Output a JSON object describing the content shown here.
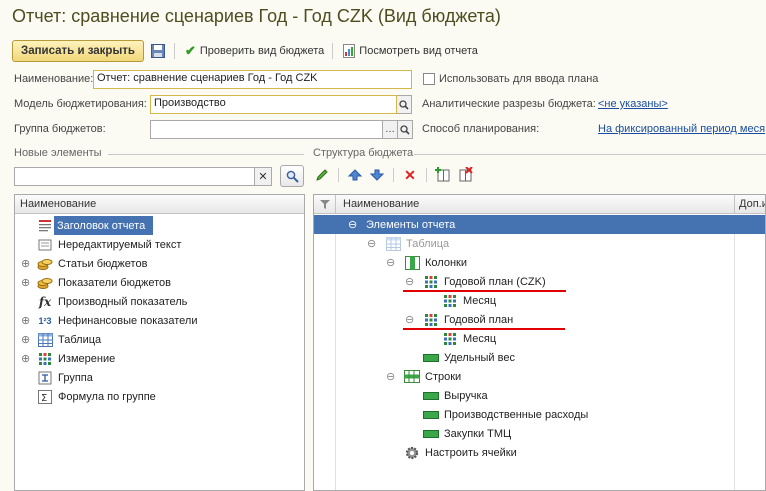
{
  "window": {
    "title": "Отчет: сравнение сценариев Год - Год CZK (Вид бюджета)"
  },
  "toolbar": {
    "save_close": "Записать и закрыть",
    "check": "Проверить вид бюджета",
    "view_report": "Посмотреть вид отчета"
  },
  "form": {
    "name_label": "Наименование:",
    "name_value": "Отчет: сравнение сценариев Год - Год CZK",
    "use_plan_label": "Использовать для ввода плана",
    "model_label": "Модель бюджетирования:",
    "model_value": "Производство",
    "analytics_label": "Аналитические разрезы бюджета:",
    "analytics_value": "<не указаны>",
    "group_label": "Группа бюджетов:",
    "group_value": "",
    "method_label": "Способ планирования:",
    "method_value": "На фиксированный период меся"
  },
  "new_elements": {
    "title": "Новые элементы",
    "search_value": "",
    "column": "Наименование",
    "items": [
      {
        "label": "Заголовок отчета",
        "icon": "header-icon",
        "expandable": false,
        "selected": true
      },
      {
        "label": "Нередактируемый текст",
        "icon": "text-icon",
        "expandable": false
      },
      {
        "label": "Статьи бюджетов",
        "icon": "coins-icon",
        "expandable": true
      },
      {
        "label": "Показатели бюджетов",
        "icon": "coins-icon",
        "expandable": true
      },
      {
        "label": "Производный показатель",
        "icon": "fx-icon",
        "expandable": false
      },
      {
        "label": "Нефинансовые показатели",
        "icon": "numbers-icon",
        "expandable": true
      },
      {
        "label": "Таблица",
        "icon": "table-icon",
        "expandable": true
      },
      {
        "label": "Измерение",
        "icon": "grid-icon",
        "expandable": true
      },
      {
        "label": "Группа",
        "icon": "group-icon",
        "expandable": false
      },
      {
        "label": "Формула по группе",
        "icon": "sigma-icon",
        "expandable": false
      }
    ]
  },
  "structure": {
    "title": "Структура бюджета",
    "col_name": "Наименование",
    "col_extra": "Доп.и",
    "rows": [
      {
        "label": "Элементы отчета",
        "level": 0,
        "exp": "⊖",
        "icon": "",
        "selected": true
      },
      {
        "label": "Таблица",
        "level": 1,
        "exp": "⊖",
        "icon": "table-icon",
        "grey": true
      },
      {
        "label": "Колонки",
        "level": 2,
        "exp": "⊖",
        "icon": "columns-icon"
      },
      {
        "label": "Годовой план (CZK)",
        "level": 3,
        "exp": "⊖",
        "icon": "grid-icon"
      },
      {
        "label": "Месяц",
        "level": 4,
        "exp": "",
        "icon": "grid-icon"
      },
      {
        "label": "Годовой план",
        "level": 3,
        "exp": "⊖",
        "icon": "grid-icon"
      },
      {
        "label": "Месяц",
        "level": 4,
        "exp": "",
        "icon": "grid-icon"
      },
      {
        "label": "Удельный вес",
        "level": 3,
        "exp": "",
        "icon": "bar-icon"
      },
      {
        "label": "Строки",
        "level": 2,
        "exp": "⊖",
        "icon": "rows-icon"
      },
      {
        "label": "Выручка",
        "level": 3,
        "exp": "",
        "icon": "bar-icon"
      },
      {
        "label": "Производственные расходы",
        "level": 3,
        "exp": "",
        "icon": "bar-icon"
      },
      {
        "label": "Закупки ТМЦ",
        "level": 3,
        "exp": "",
        "icon": "bar-icon"
      },
      {
        "label": "Настроить ячейки",
        "level": 2,
        "exp": "",
        "icon": "gear-icon"
      }
    ]
  },
  "colors": {
    "selection": "#4572b0",
    "accent_red": "#e00000"
  }
}
